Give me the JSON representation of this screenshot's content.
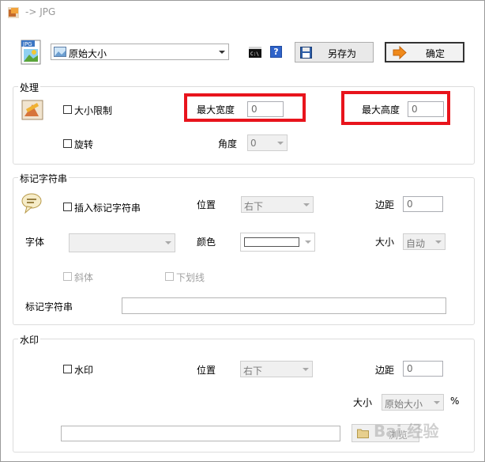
{
  "window": {
    "title": "-> JPG"
  },
  "toolbar": {
    "size_mode": "原始大小",
    "save_as_label": "另存为",
    "ok_label": "确定",
    "cmd_icon": "command-prompt-icon",
    "help_icon": "help-icon",
    "help_glyph": "?"
  },
  "processing": {
    "title": "处理",
    "size_limit_label": "大小限制",
    "size_limit_checked": false,
    "max_width_label": "最大宽度",
    "max_width_value": "0",
    "max_height_label": "最大高度",
    "max_height_value": "0",
    "rotate_label": "旋转",
    "rotate_checked": false,
    "angle_label": "角度",
    "angle_value": "0"
  },
  "mark_string": {
    "title": "标记字符串",
    "insert_label": "插入标记字符串",
    "insert_checked": false,
    "position_label": "位置",
    "position_value": "右下",
    "margin_label": "边距",
    "margin_value": "0",
    "font_label": "字体",
    "font_value": "",
    "color_label": "颜色",
    "size_label": "大小",
    "size_value": "自动",
    "italic_label": "斜体",
    "underline_label": "下划线",
    "string_label": "标记字符串",
    "string_value": ""
  },
  "watermark": {
    "title": "水印",
    "enable_label": "水印",
    "enable_checked": false,
    "position_label": "位置",
    "position_value": "右下",
    "margin_label": "边距",
    "margin_value": "0",
    "size_label": "大小",
    "size_value": "原始大小",
    "percent_sign": "%",
    "file_value": "",
    "browse_label": "浏览"
  },
  "overlay": {
    "site_watermark": "Bai 经验"
  },
  "colors": {
    "highlight": "#e8141c",
    "group_border": "#dcdcdc"
  }
}
